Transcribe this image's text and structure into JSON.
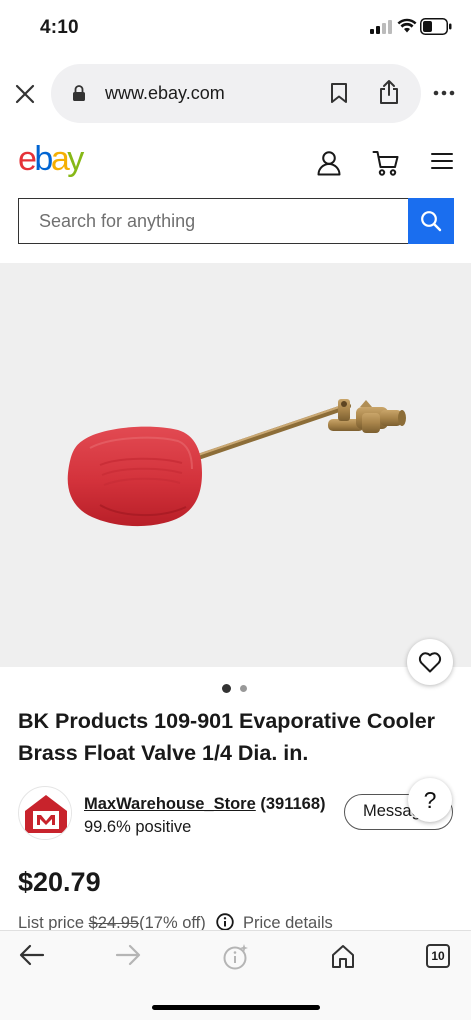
{
  "status": {
    "time": "4:10"
  },
  "browser": {
    "url": "www.ebay.com"
  },
  "header": {
    "logo": [
      "e",
      "b",
      "a",
      "y"
    ]
  },
  "search": {
    "placeholder": "Search for anything"
  },
  "gallery": {
    "active_dot": 1,
    "dot_count": 2
  },
  "product": {
    "title": "BK Products 109-901 Evaporative Cooler Brass Float Valve 1/4 Dia. in.",
    "seller_name": "MaxWarehouse_Store",
    "seller_feedback": "(391168)",
    "seller_positive": "99.6% positive",
    "message_label": "Message",
    "help_label": "?",
    "price": "$20.79",
    "list_price_label": "List price",
    "list_price": "$24.95",
    "discount": "(17% off)",
    "price_details": "Price details"
  },
  "toolbar": {
    "tab_count": "10"
  },
  "colors": {
    "accent": "#1a6eef",
    "float_red": "#d9363e",
    "brass": "#a8844a"
  }
}
